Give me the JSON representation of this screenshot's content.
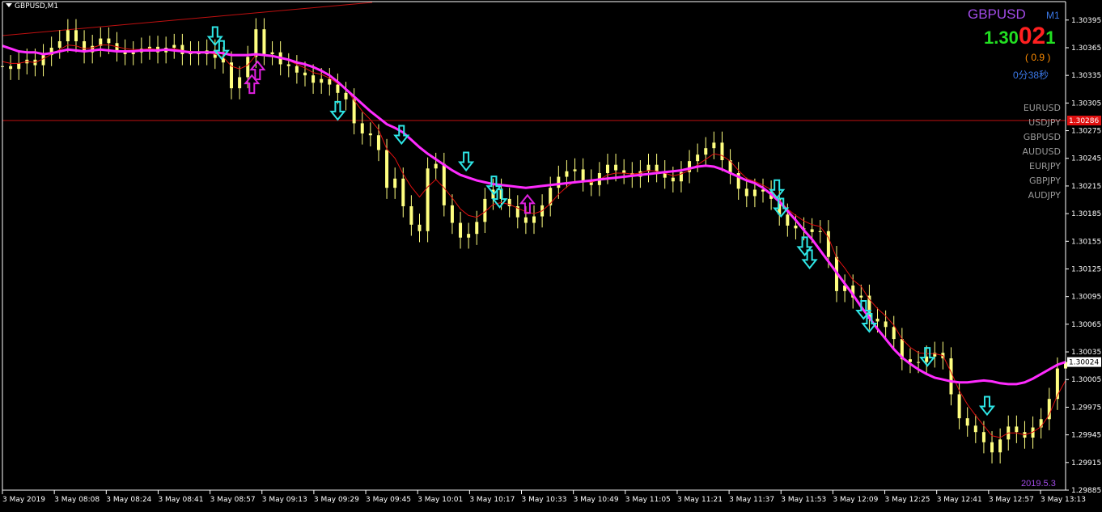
{
  "chart_title": "GBPUSD,M1",
  "info": {
    "symbol": "GBPUSD",
    "timeframe": "M1",
    "price_prefix": "1.30",
    "price_big": "02",
    "price_last": "1",
    "spread": "( 0.9 )",
    "timer": "0分38秒",
    "date": "2019.5.3",
    "symbol_list": [
      "EURUSD",
      "USDJPY",
      "GBPUSD",
      "AUDUSD",
      "EURJPY",
      "GBPJPY",
      "AUDJPY"
    ]
  },
  "colors": {
    "background": "#000000",
    "candles": "#ffff80",
    "ma_slow": "#ff2bff",
    "ma_fast": "#e01010",
    "arrow_down": "#2ee6e6",
    "arrow_up": "#e020e0",
    "hline": "#c01010",
    "trendline": "#c01010",
    "current_price_box": "#ffffff",
    "hline_price_box": "#e01010"
  },
  "chart_data": {
    "type": "candlestick",
    "series": [
      {
        "name": "",
        "kind": "candles"
      },
      {
        "name": "",
        "kind": "ma_slow"
      },
      {
        "name": "",
        "kind": "ma_fast"
      }
    ],
    "y_ticks": [
      "1.30395",
      "1.30365",
      "1.30335",
      "1.30305",
      "1.30275",
      "1.30245",
      "1.30215",
      "1.30185",
      "1.30155",
      "1.30125",
      "1.30095",
      "1.30065",
      "1.30035",
      "1.30005",
      "1.29975",
      "1.29945",
      "1.29915",
      "1.29885"
    ],
    "ylim": [
      1.29885,
      1.30415
    ],
    "x_ticks": [
      "3 May 2019",
      "3 May 08:08",
      "3 May 08:24",
      "3 May 08:41",
      "3 May 08:57",
      "3 May 09:13",
      "3 May 09:29",
      "3 May 09:45",
      "3 May 10:01",
      "3 May 10:17",
      "3 May 10:33",
      "3 May 10:49",
      "3 May 11:05",
      "3 May 11:21",
      "3 May 11:37",
      "3 May 11:53",
      "3 May 12:09",
      "3 May 12:25",
      "3 May 12:41",
      "3 May 12:57",
      "3 May 13:13"
    ],
    "current_price": "1.30024",
    "hline_price": "1.30286",
    "x_index": [
      0,
      10,
      20,
      30,
      40,
      50,
      60,
      70,
      80,
      90,
      100,
      110,
      120,
      130,
      140,
      150,
      160,
      170,
      180,
      190,
      200,
      210,
      220,
      230,
      240,
      250,
      260,
      270,
      280,
      290,
      300,
      310,
      320,
      330,
      340,
      350,
      360,
      370,
      380,
      390,
      400,
      410,
      420,
      430,
      440,
      450,
      460,
      470,
      480,
      490,
      500,
      510,
      520,
      530,
      540,
      550,
      560,
      570,
      580,
      590,
      600,
      610,
      620,
      630,
      640,
      650,
      660,
      670,
      680,
      690,
      700,
      710,
      720,
      730,
      740,
      750,
      760,
      770,
      780,
      790,
      800,
      810,
      820,
      830,
      840,
      850,
      860,
      870,
      880,
      890,
      900,
      910,
      920,
      930,
      940,
      950,
      960,
      970,
      980,
      990,
      1000,
      1010,
      1020,
      1030,
      1040,
      1050,
      1060,
      1070,
      1080,
      1090,
      1100,
      1110,
      1120,
      1130,
      1140,
      1150,
      1160,
      1170,
      1180,
      1190,
      1200,
      1210,
      1220,
      1230,
      1240,
      1250,
      1260,
      1270,
      1280,
      1290,
      1300
    ],
    "close": [
      1.30345,
      1.30342,
      1.30348,
      1.30352,
      1.30346,
      1.30357,
      1.30365,
      1.30372,
      1.30384,
      1.30372,
      1.3036,
      1.30367,
      1.30375,
      1.3037,
      1.30362,
      1.30358,
      1.3036,
      1.30364,
      1.30366,
      1.3036,
      1.30365,
      1.30368,
      1.30358,
      1.3036,
      1.30358,
      1.30362,
      1.30354,
      1.30349,
      1.30321,
      1.30333,
      1.30355,
      1.30385,
      1.30358,
      1.3036,
      1.30347,
      1.30345,
      1.30338,
      1.30335,
      1.30327,
      1.30331,
      1.30325,
      1.30316,
      1.30309,
      1.30283,
      1.30272,
      1.3027,
      1.30254,
      1.30213,
      1.30223,
      1.30193,
      1.30173,
      1.30166,
      1.30234,
      1.30239,
      1.30194,
      1.30175,
      1.30159,
      1.30163,
      1.30176,
      1.30201,
      1.30211,
      1.30201,
      1.30193,
      1.30181,
      1.30175,
      1.30182,
      1.30194,
      1.30213,
      1.30225,
      1.30231,
      1.30233,
      1.30221,
      1.30216,
      1.30229,
      1.30238,
      1.30232,
      1.30229,
      1.30225,
      1.30231,
      1.30238,
      1.30231,
      1.30224,
      1.3022,
      1.3023,
      1.30242,
      1.30249,
      1.30256,
      1.30262,
      1.30243,
      1.30229,
      1.30212,
      1.30204,
      1.30211,
      1.30209,
      1.30201,
      1.30184,
      1.30172,
      1.30169,
      1.30168,
      1.30165,
      1.30166,
      1.30138,
      1.30101,
      1.30107,
      1.30094,
      1.30096,
      1.30071,
      1.30068,
      1.30062,
      1.30049,
      1.30027,
      1.30024,
      1.30024,
      1.3003,
      1.30034,
      1.30028,
      1.29989,
      1.29963,
      1.29955,
      1.29948,
      1.29937,
      1.29926,
      1.2994,
      1.29954,
      1.29948,
      1.29942,
      1.29953,
      1.29962,
      1.29984,
      1.30017,
      1.30024
    ],
    "ma_slow": [
      1.30367,
      1.30364,
      1.30361,
      1.3036,
      1.3036,
      1.30358,
      1.30359,
      1.30361,
      1.30363,
      1.30362,
      1.30361,
      1.30362,
      1.30363,
      1.30362,
      1.30361,
      1.30361,
      1.30361,
      1.30362,
      1.30362,
      1.30362,
      1.30363,
      1.30362,
      1.30361,
      1.3036,
      1.3036,
      1.3036,
      1.3036,
      1.30359,
      1.30357,
      1.30357,
      1.30357,
      1.30358,
      1.30357,
      1.30356,
      1.30354,
      1.30352,
      1.30349,
      1.30347,
      1.30344,
      1.3034,
      1.30335,
      1.30328,
      1.3032,
      1.30312,
      1.30304,
      1.30296,
      1.30289,
      1.30282,
      1.30278,
      1.30273,
      1.30265,
      1.30257,
      1.3025,
      1.30244,
      1.30238,
      1.30232,
      1.30227,
      1.30224,
      1.30221,
      1.30219,
      1.30217,
      1.30216,
      1.30215,
      1.30214,
      1.30213,
      1.30214,
      1.30215,
      1.30216,
      1.30217,
      1.30218,
      1.30219,
      1.3022,
      1.30221,
      1.30222,
      1.30223,
      1.30224,
      1.30225,
      1.30226,
      1.30227,
      1.30228,
      1.30229,
      1.3023,
      1.30231,
      1.30232,
      1.30234,
      1.30236,
      1.30237,
      1.30236,
      1.30233,
      1.30229,
      1.30225,
      1.30221,
      1.30218,
      1.30213,
      1.30206,
      1.30198,
      1.30188,
      1.30178,
      1.30167,
      1.30157,
      1.30145,
      1.30133,
      1.30121,
      1.30109,
      1.30097,
      1.30084,
      1.30072,
      1.3006,
      1.30049,
      1.30038,
      1.30029,
      1.30022,
      1.30016,
      1.30011,
      1.30007,
      1.30005,
      1.30003,
      1.30002,
      1.30002,
      1.30003,
      1.30004,
      1.30003,
      1.30001,
      1.3,
      1.3,
      1.30002,
      1.30006,
      1.30011,
      1.30016,
      1.30021,
      1.30024
    ],
    "ma_fast": [
      1.3035,
      1.30348,
      1.30348,
      1.3035,
      1.30349,
      1.30353,
      1.30358,
      1.30363,
      1.30368,
      1.30367,
      1.30364,
      1.30365,
      1.30368,
      1.30368,
      1.30366,
      1.30364,
      1.30363,
      1.30363,
      1.30364,
      1.30363,
      1.30363,
      1.30364,
      1.30362,
      1.30361,
      1.3036,
      1.3036,
      1.30358,
      1.30355,
      1.30345,
      1.30342,
      1.30346,
      1.30357,
      1.30357,
      1.30357,
      1.30354,
      1.30351,
      1.30347,
      1.30343,
      1.30338,
      1.30336,
      1.30332,
      1.30326,
      1.30321,
      1.30308,
      1.30296,
      1.30287,
      1.30276,
      1.30255,
      1.30245,
      1.30228,
      1.30214,
      1.30203,
      1.30214,
      1.30222,
      1.30213,
      1.30202,
      1.3019,
      1.30183,
      1.30181,
      1.30187,
      1.30195,
      1.30197,
      1.30195,
      1.30191,
      1.30187,
      1.30185,
      1.30188,
      1.30196,
      1.30206,
      1.30214,
      1.3022,
      1.3022,
      1.30219,
      1.30222,
      1.30227,
      1.30229,
      1.30229,
      1.30228,
      1.30229,
      1.30232,
      1.30231,
      1.30229,
      1.30226,
      1.30228,
      1.30232,
      1.30238,
      1.30244,
      1.3025,
      1.30248,
      1.30242,
      1.30232,
      1.30223,
      1.3022,
      1.30216,
      1.30211,
      1.302,
      1.3019,
      1.30183,
      1.30177,
      1.30173,
      1.30171,
      1.30159,
      1.30137,
      1.30126,
      1.30113,
      1.30106,
      1.30092,
      1.30082,
      1.30074,
      1.30064,
      1.30049,
      1.3004,
      1.30034,
      1.30033,
      1.30033,
      1.30031,
      1.30013,
      1.29993,
      1.29978,
      1.29966,
      1.29955,
      1.29944,
      1.29942,
      1.29947,
      1.29947,
      1.29945,
      1.29948,
      1.29954,
      1.29967,
      1.29988,
      1.30004
    ],
    "markers": [
      {
        "dir": "down",
        "x": 260,
        "price": 1.30368
      },
      {
        "dir": "down",
        "x": 268,
        "price": 1.30353
      },
      {
        "dir": "up",
        "x": 305,
        "price": 1.30335
      },
      {
        "dir": "up",
        "x": 312,
        "price": 1.3035
      },
      {
        "dir": "down",
        "x": 410,
        "price": 1.30287
      },
      {
        "dir": "down",
        "x": 488,
        "price": 1.30261
      },
      {
        "dir": "down",
        "x": 567,
        "price": 1.30232
      },
      {
        "dir": "down",
        "x": 601,
        "price": 1.30206
      },
      {
        "dir": "down",
        "x": 608,
        "price": 1.30192
      },
      {
        "dir": "up",
        "x": 642,
        "price": 1.30205
      },
      {
        "dir": "down",
        "x": 947,
        "price": 1.30202
      },
      {
        "dir": "down",
        "x": 952,
        "price": 1.30182
      },
      {
        "dir": "down",
        "x": 981,
        "price": 1.3014
      },
      {
        "dir": "down",
        "x": 987,
        "price": 1.30126
      },
      {
        "dir": "down",
        "x": 1053,
        "price": 1.30071
      },
      {
        "dir": "down",
        "x": 1060,
        "price": 1.30057
      },
      {
        "dir": "down",
        "x": 1131,
        "price": 1.3002
      },
      {
        "dir": "down",
        "x": 1204,
        "price": 1.29967
      }
    ],
    "grid": false
  }
}
